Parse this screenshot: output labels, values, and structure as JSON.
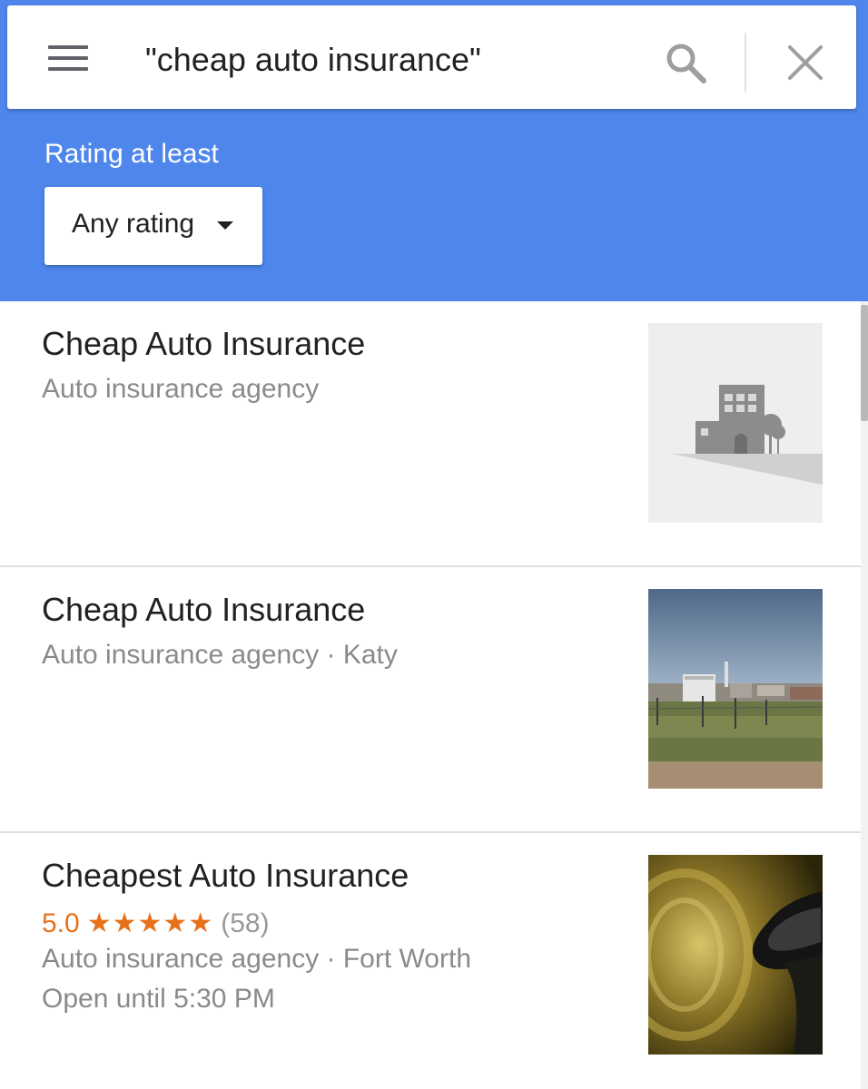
{
  "search": {
    "query": "\"cheap auto insurance\""
  },
  "filter": {
    "label": "Rating at least",
    "selected": "Any rating"
  },
  "results": [
    {
      "title": "Cheap Auto Insurance",
      "subtitle": "Auto insurance agency",
      "image": "placeholder-building"
    },
    {
      "title": "Cheap Auto Insurance",
      "subtitle": "Auto insurance agency · Katy",
      "image": "street-view-photo"
    },
    {
      "title": "Cheapest Auto Insurance",
      "rating": "5.0",
      "stars": "★★★★★",
      "reviews": "(58)",
      "subtitle": "Auto insurance agency · Fort Worth",
      "hours": "Open until 5:30 PM",
      "image": "car-mirror-photo"
    }
  ],
  "colors": {
    "header_blue": "#4f86ec",
    "rating_orange": "#e7711b",
    "secondary_text": "#8a8a8a"
  },
  "icons": {
    "menu": "hamburger-menu-icon",
    "search": "search-icon",
    "close": "close-icon",
    "dropdown": "caret-down-icon"
  }
}
